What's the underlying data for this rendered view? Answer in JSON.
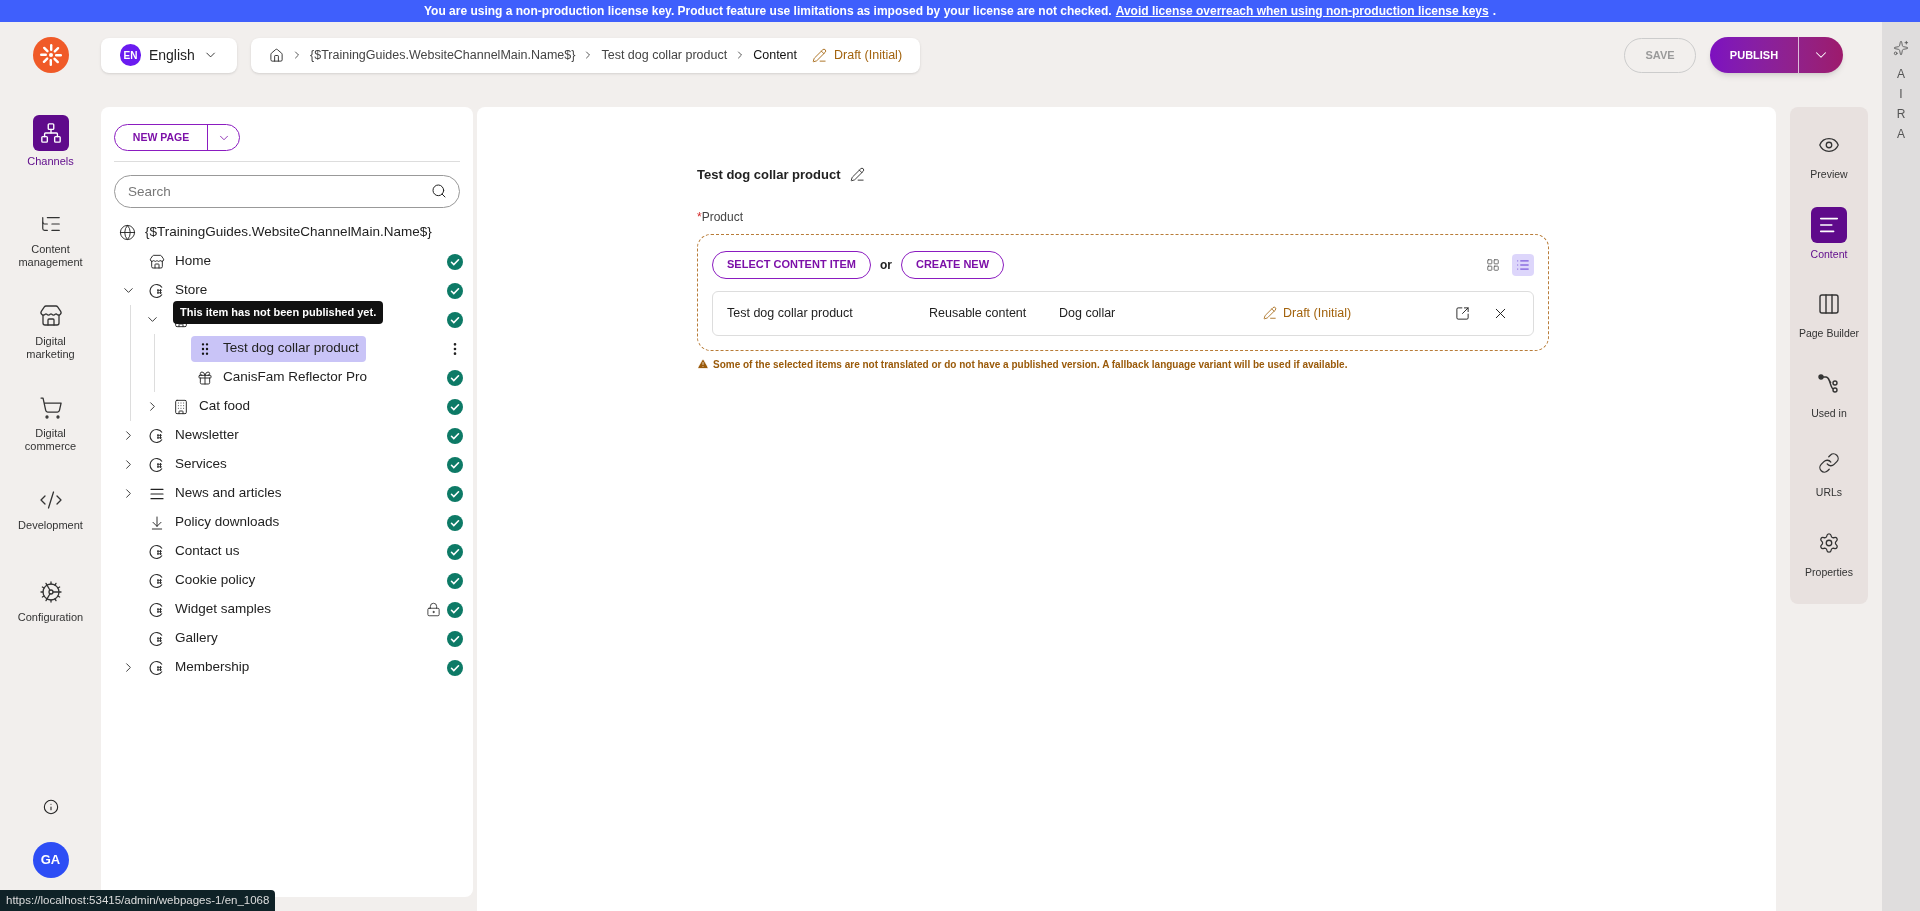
{
  "banner": {
    "text": "You are using a non-production license key. Product feature use limitations as imposed by your license are not checked.",
    "link": "Avoid license overreach when using non-production license keys",
    "suffix": "."
  },
  "language": {
    "code": "EN",
    "name": "English"
  },
  "breadcrumb": {
    "items": [
      "{$TrainingGuides.WebsiteChannelMain.Name$}",
      "Test dog collar product"
    ],
    "current": "Content",
    "status": "Draft (Initial)"
  },
  "actions": {
    "save": {
      "label": "SAVE",
      "disabled": true
    },
    "publish": {
      "label": "PUBLISH"
    }
  },
  "aira": {
    "letters": [
      "A",
      "I",
      "R",
      "A"
    ]
  },
  "nav": [
    {
      "label": "Channels",
      "selected": true
    },
    {
      "label": "Content management",
      "selected": false
    },
    {
      "label": "Digital marketing",
      "selected": false
    },
    {
      "label": "Digital commerce",
      "selected": false
    },
    {
      "label": "Development",
      "selected": false
    },
    {
      "label": "Configuration",
      "selected": false
    }
  ],
  "user": {
    "initials": "GA"
  },
  "tree_panel": {
    "new_page": "NEW PAGE",
    "search_placeholder": "Search"
  },
  "tree": {
    "label": "{$TrainingGuides.WebsiteChannelMain.Name$}",
    "children": [
      {
        "kind": "home",
        "label": "Home",
        "published": true
      },
      {
        "kind": "page",
        "label": "Store",
        "published": true,
        "expanded": true,
        "children": [
          {
            "kind": "category",
            "published": true,
            "expanded": true,
            "tooltip": "This item has not been published yet.",
            "children": [
              {
                "kind": "item",
                "label": "Test dog collar product",
                "published": false,
                "selected": true
              },
              {
                "kind": "product",
                "label": "CanisFam Reflector Pro",
                "published": true,
                "selected": false
              }
            ]
          },
          {
            "kind": "category",
            "label": "Cat food",
            "published": true,
            "expanded": false
          }
        ]
      },
      {
        "kind": "page",
        "label": "Newsletter",
        "published": true,
        "expanded": false
      },
      {
        "kind": "page",
        "label": "Services",
        "published": true,
        "expanded": false
      },
      {
        "kind": "list",
        "label": "News and articles",
        "published": true,
        "expanded": false
      },
      {
        "kind": "download",
        "label": "Policy downloads",
        "published": true
      },
      {
        "kind": "page",
        "label": "Contact us",
        "published": true
      },
      {
        "kind": "page",
        "label": "Cookie policy",
        "published": true
      },
      {
        "kind": "page",
        "label": "Widget samples",
        "published": true,
        "locked": true
      },
      {
        "kind": "page",
        "label": "Gallery",
        "published": true
      },
      {
        "kind": "page",
        "label": "Membership",
        "published": true,
        "expanded": false
      }
    ]
  },
  "content": {
    "title": "Test dog collar product",
    "field": {
      "label": "Product",
      "required": true,
      "required_mark": "*",
      "select": "SELECT CONTENT ITEM",
      "or": "or",
      "create": "CREATE NEW",
      "views": [
        {
          "kind": "grid",
          "selected": false
        },
        {
          "kind": "list",
          "selected": true
        }
      ],
      "items": [
        {
          "name": "Test dog collar product",
          "type": "Reusable content",
          "content_type": "Dog collar",
          "status": "Draft (Initial)"
        }
      ],
      "warning": "Some of the selected items are not translated or do not have a published version. A fallback language variant will be used if available."
    }
  },
  "side_tabs": [
    {
      "label": "Preview",
      "selected": false
    },
    {
      "label": "Content",
      "selected": true
    },
    {
      "label": "Page Builder",
      "selected": false
    },
    {
      "label": "Used in",
      "selected": false
    },
    {
      "label": "URLs",
      "selected": false
    },
    {
      "label": "Properties",
      "selected": false
    }
  ],
  "status_url": "https://localhost:53415/admin/webpages-1/en_1068"
}
